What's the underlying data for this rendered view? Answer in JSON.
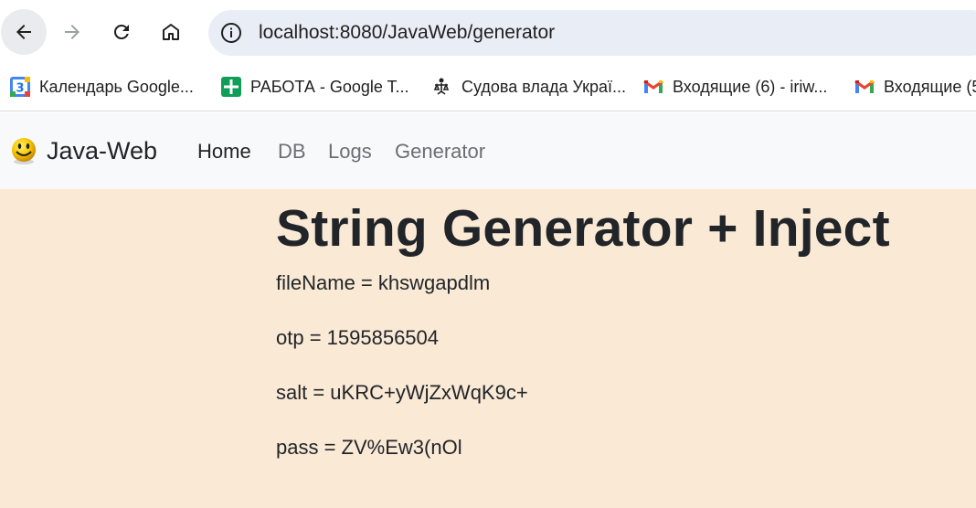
{
  "browser": {
    "url": "localhost:8080/JavaWeb/generator",
    "bookmarks": [
      {
        "label": "Календарь Google...",
        "icon": "google-calendar-icon"
      },
      {
        "label": "РАБОТА - Google T...",
        "icon": "google-sheets-icon"
      },
      {
        "label": "Судова влада Украї...",
        "icon": "court-emblem-icon"
      },
      {
        "label": "Входящие (6) - iriw...",
        "icon": "gmail-icon"
      },
      {
        "label": "Входящие (5",
        "icon": "gmail-icon"
      }
    ]
  },
  "navbar": {
    "brand": "Java-Web",
    "links": [
      "Home",
      "DB",
      "Logs",
      "Generator"
    ]
  },
  "main": {
    "title": "String Generator + Inject",
    "rows": [
      "fileName = khswgapdlm",
      "otp = 1595856504",
      "salt = uKRC+yWjZxWqK9c+",
      "pass = ZV%Ew3(nOl"
    ]
  },
  "colors": {
    "page_background": "#fae9d5",
    "navbar_background": "#f8f9fa",
    "omnibox_background": "#e9eef6"
  }
}
